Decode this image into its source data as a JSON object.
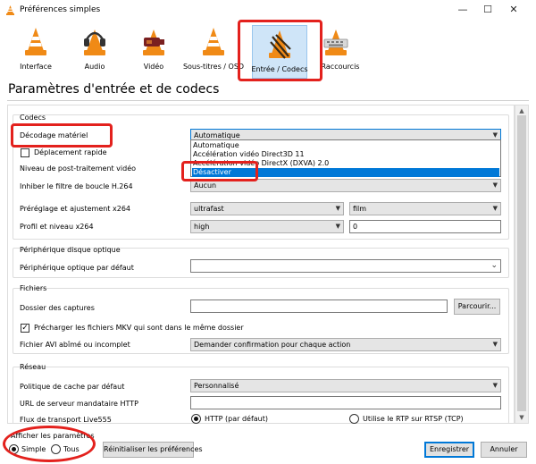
{
  "window": {
    "title": "Préférences simples",
    "minimize": "—",
    "maximize": "☐",
    "close": "✕"
  },
  "toolbar": {
    "items": [
      {
        "label": "Interface",
        "icon": "vlc-cone-icon"
      },
      {
        "label": "Audio",
        "icon": "headphones-cone-icon"
      },
      {
        "label": "Vidéo",
        "icon": "video-cone-icon"
      },
      {
        "label": "Sous-titres / OSD",
        "icon": "subtitles-cone-icon"
      },
      {
        "label": "Entrée / Codecs",
        "icon": "codecs-cone-icon",
        "active": true
      },
      {
        "label": "Raccourcis",
        "icon": "hotkeys-cone-icon"
      }
    ]
  },
  "page_title": "Paramètres d'entrée et de codecs",
  "codecs": {
    "title": "Codecs",
    "hw_decoding_label": "Décodage matériel",
    "hw_decoding_value": "Automatique",
    "hw_options": [
      "Automatique",
      "Accélération vidéo Direct3D 11",
      "Accélération vidéo DirectX (DXVA) 2.0",
      "Désactiver"
    ],
    "fast_seek_label": "Déplacement rapide",
    "postproc_label": "Niveau de post-traitement vidéo",
    "loop_filter_label": "Inhiber le filtre de boucle H.264",
    "loop_filter_value": "Aucun",
    "x264_preset_label": "Préréglage et ajustement x264",
    "x264_preset_value": "ultrafast",
    "x264_tune_value": "film",
    "x264_profile_label": "Profil et niveau x264",
    "x264_profile_value": "high",
    "x264_level_value": "0"
  },
  "optical": {
    "title": "Périphérique disque optique",
    "default_label": "Périphérique optique par défaut",
    "default_value": ""
  },
  "files": {
    "title": "Fichiers",
    "captures_label": "Dossier des captures",
    "captures_value": "",
    "browse_label": "Parcourir...",
    "mkv_label": "Précharger les fichiers MKV qui sont dans le même dossier",
    "avi_label": "Fichier AVI abîmé ou incomplet",
    "avi_value": "Demander confirmation pour chaque action"
  },
  "network": {
    "title": "Réseau",
    "cache_label": "Politique de cache par défaut",
    "cache_value": "Personnalisé",
    "proxy_label": "URL de serveur mandataire HTTP",
    "proxy_value": "",
    "live555_label": "Flux de transport Live555",
    "http_option": "HTTP (par défaut)",
    "rtp_option": "Utilise le RTP sur RTSP (TCP)"
  },
  "footer": {
    "show_settings_label": "Afficher les paramètres",
    "simple_label": "Simple",
    "all_label": "Tous",
    "reset_label": "Réinitialiser les préférences",
    "save_label": "Enregistrer",
    "cancel_label": "Annuler"
  },
  "colors": {
    "highlight": "#e3211d",
    "selection": "#0078d7",
    "active_tab": "#cfe5f8",
    "cone_orange": "#f08a16"
  }
}
